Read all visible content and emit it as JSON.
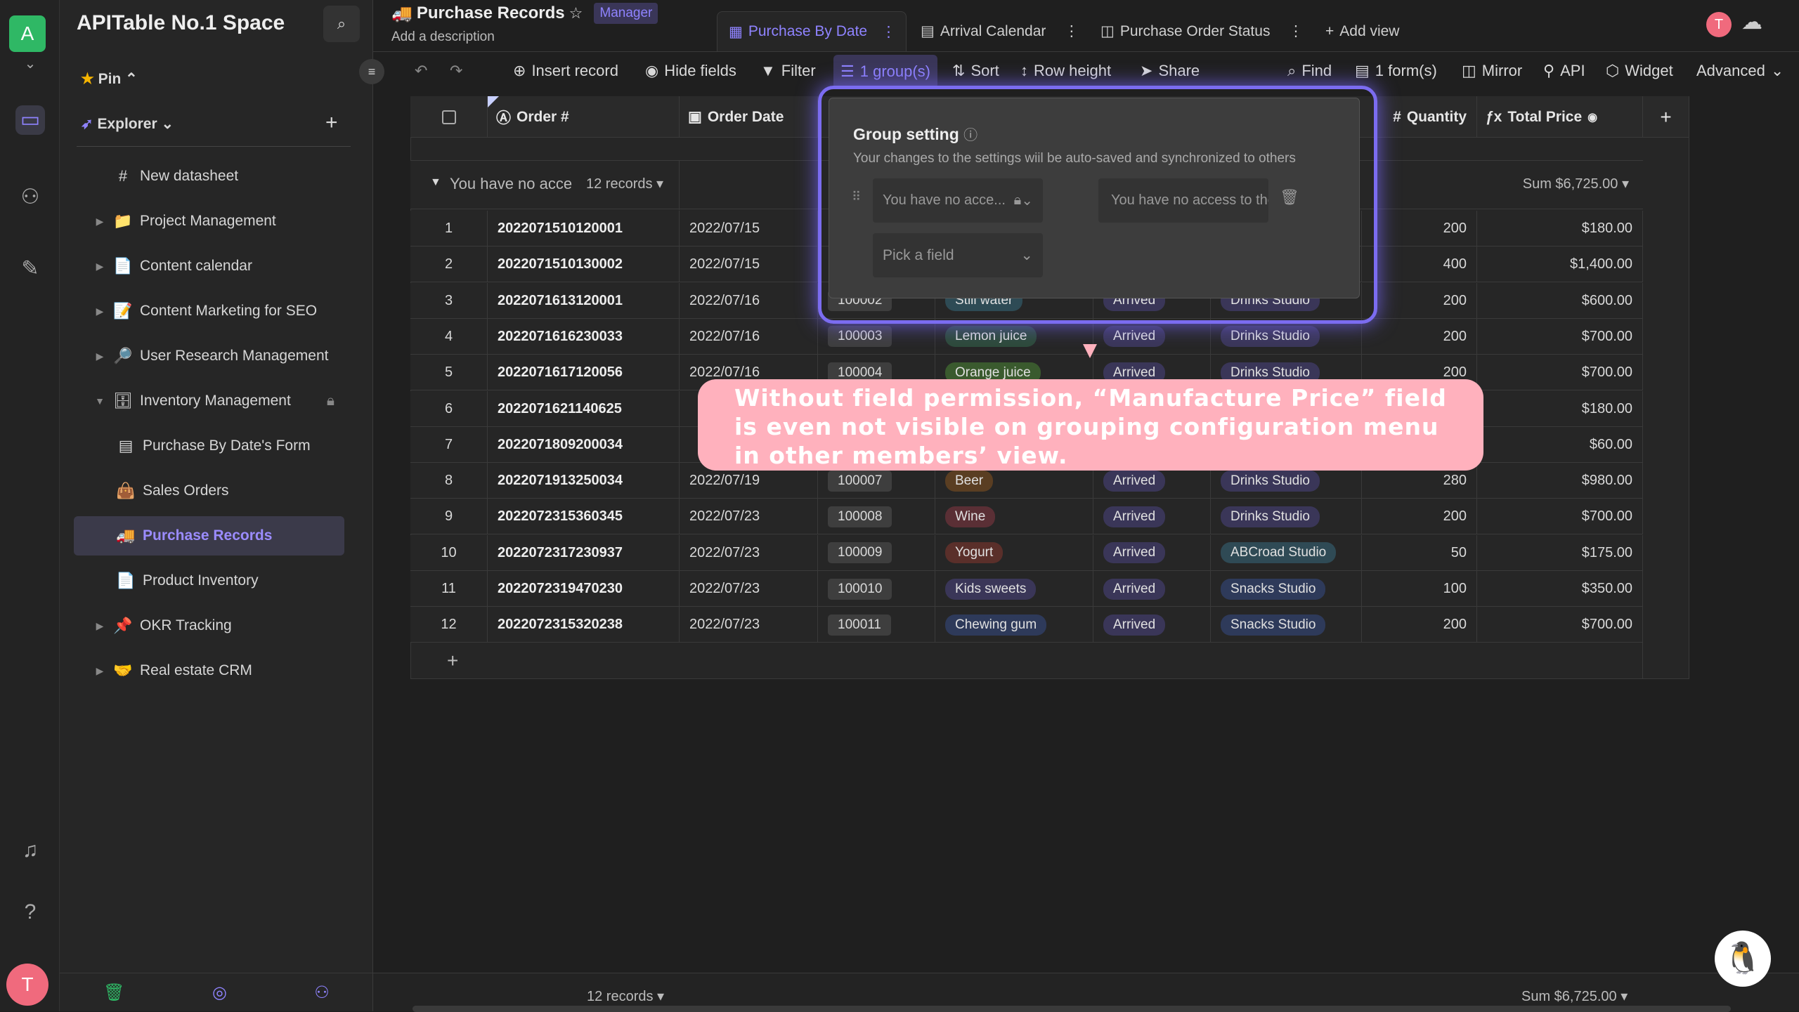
{
  "space": {
    "avatar_letter": "A",
    "name": "APITable No.1 Space",
    "user_letter": "T"
  },
  "sidebar": {
    "pin_label": "Pin",
    "explorer_label": "Explorer",
    "items": [
      {
        "label": "New datasheet",
        "icon": "hash",
        "expand": false,
        "indent": 0
      },
      {
        "label": "Project Management",
        "icon": "folder",
        "expand": true,
        "indent": 0
      },
      {
        "label": "Content calendar",
        "icon": "doc",
        "expand": true,
        "indent": 0
      },
      {
        "label": "Content Marketing for SEO",
        "icon": "memo",
        "expand": true,
        "indent": 0
      },
      {
        "label": "User Research Management",
        "icon": "magnifier",
        "expand": true,
        "indent": 0
      },
      {
        "label": "Inventory Management",
        "icon": "cabinet",
        "expand": true,
        "indent": 0,
        "open": true,
        "locked": true
      },
      {
        "label": "Purchase By Date's Form",
        "icon": "form",
        "indent": 1
      },
      {
        "label": "Sales Orders",
        "icon": "bag",
        "indent": 1
      },
      {
        "label": "Purchase Records",
        "icon": "truck",
        "indent": 1,
        "active": true
      },
      {
        "label": "Product Inventory",
        "icon": "doc",
        "indent": 1
      },
      {
        "label": "OKR Tracking",
        "icon": "pin",
        "expand": true,
        "indent": 0
      },
      {
        "label": "Real estate CRM",
        "icon": "handshake",
        "expand": true,
        "indent": 0
      }
    ]
  },
  "header": {
    "title": "Purchase Records",
    "role_badge": "Manager",
    "description": "Add a description",
    "tabs": [
      {
        "label": "Purchase By Date",
        "active": true
      },
      {
        "label": "Arrival Calendar"
      },
      {
        "label": "Purchase Order Status"
      }
    ],
    "add_view": "Add view"
  },
  "toolbar": {
    "insert": "Insert record",
    "hide": "Hide fields",
    "filter": "Filter",
    "group": "1 group(s)",
    "sort": "Sort",
    "row_height": "Row height",
    "share": "Share",
    "find": "Find",
    "forms": "1 form(s)",
    "mirror": "Mirror",
    "api": "API",
    "widget": "Widget",
    "advanced": "Advanced"
  },
  "table": {
    "headers": {
      "order": "Order #",
      "date": "Order Date",
      "quantity": "Quantity",
      "total": "Total Price"
    },
    "group_label": "You have no acce",
    "group_count": "12 records",
    "group_sum": "Sum $6,725.00",
    "rows": [
      {
        "n": "1",
        "order": "2022071510120001",
        "date": "2022/07/15",
        "pid": "",
        "product": "",
        "status": "",
        "supplier": "",
        "qty": "200",
        "total": "$180.00"
      },
      {
        "n": "2",
        "order": "2022071510130002",
        "date": "2022/07/15",
        "pid": "",
        "product": "",
        "status": "",
        "supplier": "",
        "qty": "400",
        "total": "$1,400.00"
      },
      {
        "n": "3",
        "order": "2022071613120001",
        "date": "2022/07/16",
        "pid": "100002",
        "product": "Still water",
        "pc": "#2e4b55",
        "status": "Arrived",
        "supplier": "Drinks Studio",
        "sc": "#3a3658",
        "qty": "200",
        "total": "$600.00"
      },
      {
        "n": "4",
        "order": "2022071616230033",
        "date": "2022/07/16",
        "pid": "100003",
        "product": "Lemon juice",
        "pc": "#2d4a3a",
        "status": "Arrived",
        "supplier": "Drinks Studio",
        "sc": "#3a3658",
        "qty": "200",
        "total": "$700.00"
      },
      {
        "n": "5",
        "order": "2022071617120056",
        "date": "2022/07/16",
        "pid": "100004",
        "product": "Orange juice",
        "pc": "#3a5a2e",
        "status": "Arrived",
        "supplier": "Drinks Studio",
        "sc": "#3a3658",
        "qty": "200",
        "total": "$700.00"
      },
      {
        "n": "6",
        "order": "2022071621140625",
        "date": "",
        "pid": "",
        "product": "",
        "status": "",
        "supplier": "",
        "qty": "",
        "total": "$180.00"
      },
      {
        "n": "7",
        "order": "2022071809200034",
        "date": "",
        "pid": "",
        "product": "",
        "status": "",
        "supplier": "",
        "qty": "",
        "total": "$60.00"
      },
      {
        "n": "8",
        "order": "2022071913250034",
        "date": "2022/07/19",
        "pid": "100007",
        "product": "Beer",
        "pc": "#5a3e22",
        "status": "Arrived",
        "supplier": "Drinks Studio",
        "sc": "#3a3658",
        "qty": "280",
        "total": "$980.00"
      },
      {
        "n": "9",
        "order": "2022072315360345",
        "date": "2022/07/23",
        "pid": "100008",
        "product": "Wine",
        "pc": "#5a2f35",
        "status": "Arrived",
        "supplier": "Drinks Studio",
        "sc": "#3a3658",
        "qty": "200",
        "total": "$700.00"
      },
      {
        "n": "10",
        "order": "2022072317230937",
        "date": "2022/07/23",
        "pid": "100009",
        "product": "Yogurt",
        "pc": "#5a2f2a",
        "status": "Arrived",
        "supplier": "ABCroad Studio",
        "sc": "#2f4a55",
        "qty": "50",
        "total": "$175.00"
      },
      {
        "n": "11",
        "order": "2022072319470230",
        "date": "2022/07/23",
        "pid": "100010",
        "product": "Kids sweets",
        "pc": "#3a3658",
        "status": "Arrived",
        "supplier": "Snacks Studio",
        "sc": "#2e3a5a",
        "qty": "100",
        "total": "$350.00"
      },
      {
        "n": "12",
        "order": "2022072315320238",
        "date": "2022/07/23",
        "pid": "100011",
        "product": "Chewing gum",
        "pc": "#2e3a5a",
        "status": "Arrived",
        "supplier": "Snacks Studio",
        "sc": "#2e3a5a",
        "qty": "200",
        "total": "$700.00"
      }
    ],
    "status_color": "#3a3658"
  },
  "popup": {
    "title": "Group setting",
    "subtitle": "Your changes to the settings wiil be auto-saved and synchronized to others",
    "field_select": "You have no acce...",
    "order_select": "You have no access to the",
    "pick_field": "Pick a field"
  },
  "callout": {
    "text": "Without field permission, “Manufacture Price” field is even not visible on grouping configuration menu in other members’ view."
  },
  "footer": {
    "records": "12 records",
    "sum": "Sum $6,725.00"
  },
  "colors": {
    "accent": "#7b6cf0",
    "callout": "#ffb1bd"
  }
}
